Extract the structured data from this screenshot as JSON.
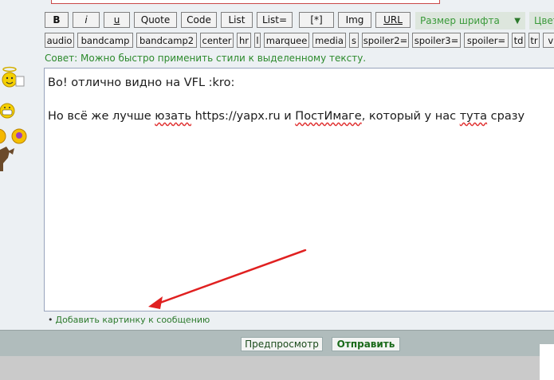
{
  "toolbar_row1": {
    "bold": "B",
    "italic": "i",
    "underline": "u",
    "quote": "Quote",
    "code": "Code",
    "list": "List",
    "list_eq": "List=",
    "list_item": "[*]",
    "img": "Img",
    "url": "URL",
    "font_size": "Размер шрифта",
    "font_size_arrow": "▼",
    "color": "Цвет"
  },
  "toolbar_row2": [
    "audio",
    "bandcamp",
    "bandcamp2",
    "center",
    "hr",
    "l",
    "marquee",
    "media",
    "s",
    "spoiler2=",
    "spoiler3=",
    "spoiler=",
    "td",
    "tr",
    "vid"
  ],
  "tip": "Совет: Можно быстро применить стили к выделенному тексту.",
  "editor": {
    "line1": "Во! отлично видно на VFL :kro:",
    "line2_a": "Но всё же лучше ",
    "line2_b": "юзать",
    "line2_c": " https://yapx.ru и ",
    "line2_d": "ПостИмаге",
    "line2_e": ", который у нас ",
    "line2_f": "тута",
    "line2_g": " сразу"
  },
  "add_picture": {
    "bullet": "•",
    "label": "Добавить картинку к сообщению"
  },
  "buttons": {
    "preview": "Предпросмотр",
    "send": "Отправить"
  },
  "colors": {
    "accent_green": "#2c8a2c",
    "arrow_red": "#e02020",
    "editor_border": "#98a4bc"
  }
}
